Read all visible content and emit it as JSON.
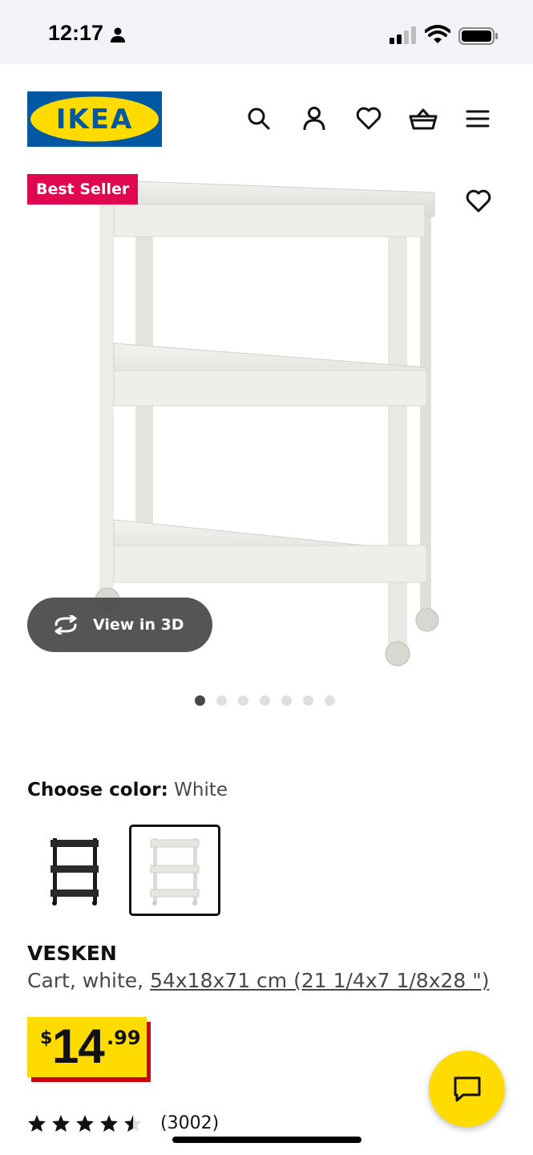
{
  "status_bar": {
    "time": "12:17"
  },
  "header": {
    "logo_text": "IKEA",
    "icons": [
      "search-icon",
      "user-icon",
      "heart-icon",
      "basket-icon",
      "menu-icon"
    ]
  },
  "product_image": {
    "badge": "Best Seller",
    "view_3d_label": "View in 3D",
    "image_count": 7,
    "active_image": 1
  },
  "color": {
    "label": "Choose color:",
    "value": "White",
    "options": [
      {
        "color": "#1b1b1b",
        "selected": false
      },
      {
        "color": "#e8e8e3",
        "selected": true
      }
    ]
  },
  "product": {
    "name": "VESKEN",
    "description_prefix": "Cart, white,",
    "dimensions_link": "54x18x71 cm (21 1/4x7 1/8x28 \")"
  },
  "price": {
    "currency": "$",
    "integer": "14",
    "decimal": ".99"
  },
  "rating": {
    "stars": 4.5,
    "max_stars": 5,
    "review_count": "(3002)"
  },
  "colors": {
    "ikea_blue": "#0058a3",
    "ikea_yellow": "#ffdb00",
    "badge_red": "#e00751",
    "price_shadow_red": "#cc0008"
  }
}
